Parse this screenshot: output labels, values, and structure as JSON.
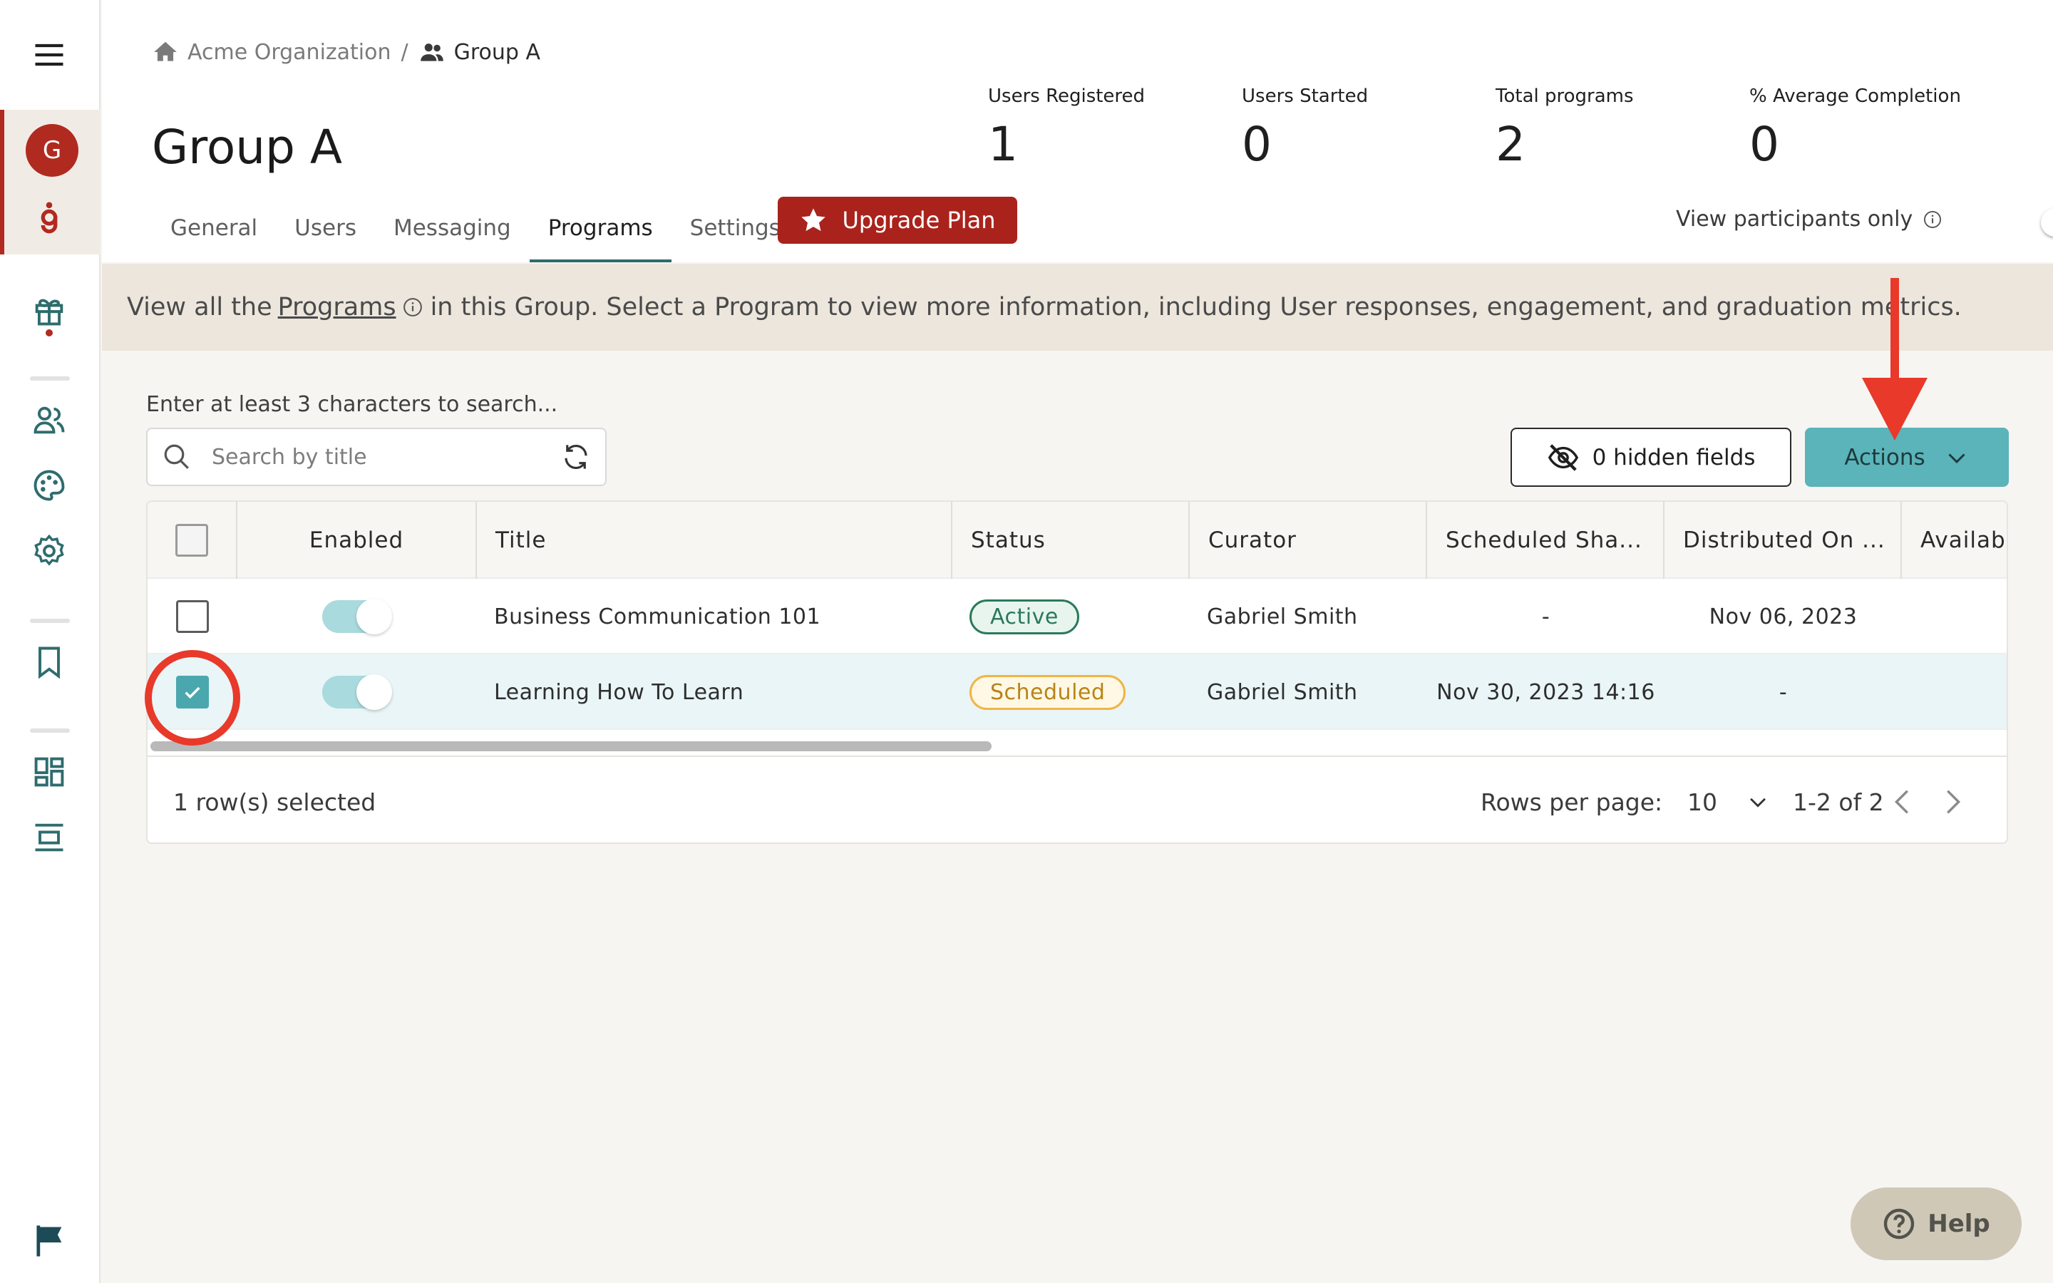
{
  "breadcrumb": {
    "org": "Acme Organization",
    "separator": "/",
    "group": "Group A"
  },
  "page": {
    "title": "Group A"
  },
  "stats": [
    {
      "label": "Users Registered",
      "value": "1"
    },
    {
      "label": "Users Started",
      "value": "0"
    },
    {
      "label": "Total programs",
      "value": "2"
    },
    {
      "label": "% Average Completion",
      "value": "0"
    }
  ],
  "tabs": [
    "General",
    "Users",
    "Messaging",
    "Programs",
    "Settings"
  ],
  "active_tab": "Programs",
  "upgrade_label": "Upgrade Plan",
  "view_participants_label": "View participants only",
  "view_participants_on": false,
  "sidebar": {
    "avatar_letter": "G",
    "icons": [
      "menu-icon",
      "logo-icon",
      "gift-icon",
      "users-icon",
      "palette-icon",
      "settings-icon",
      "bookmark-icon",
      "dashboard-icon",
      "layout-icon",
      "flag-icon"
    ]
  },
  "banner": {
    "before": "View all the",
    "link": "Programs",
    "after": "in this Group. Select a Program to view more information, including User responses, engagement, and graduation metrics."
  },
  "search": {
    "hint": "Enter at least 3 characters to search...",
    "placeholder": "Search by title",
    "value": ""
  },
  "hidden_fields_label": "0 hidden fields",
  "actions_label": "Actions",
  "table": {
    "columns": [
      "Enabled",
      "Title",
      "Status",
      "Curator",
      "Scheduled Sha...",
      "Distributed On ...",
      "Availabl"
    ],
    "rows": [
      {
        "selected": false,
        "enabled": true,
        "title": "Business Communication 101",
        "status": "Active",
        "curator": "Gabriel Smith",
        "scheduled": "-",
        "distributed": "Nov 06, 2023"
      },
      {
        "selected": true,
        "enabled": true,
        "title": "Learning How To Learn",
        "status": "Scheduled",
        "curator": "Gabriel Smith",
        "scheduled": "Nov 30, 2023 14:16",
        "distributed": "-"
      }
    ]
  },
  "footer": {
    "selected_text": "1 row(s) selected",
    "rows_per_page_label": "Rows per page:",
    "rows_per_page": "10",
    "range": "1-2 of 2"
  },
  "help_label": "Help",
  "colors": {
    "brand_red": "#a9231c",
    "accent_teal": "#5ab4ba",
    "annotation_red": "#e8392a"
  }
}
